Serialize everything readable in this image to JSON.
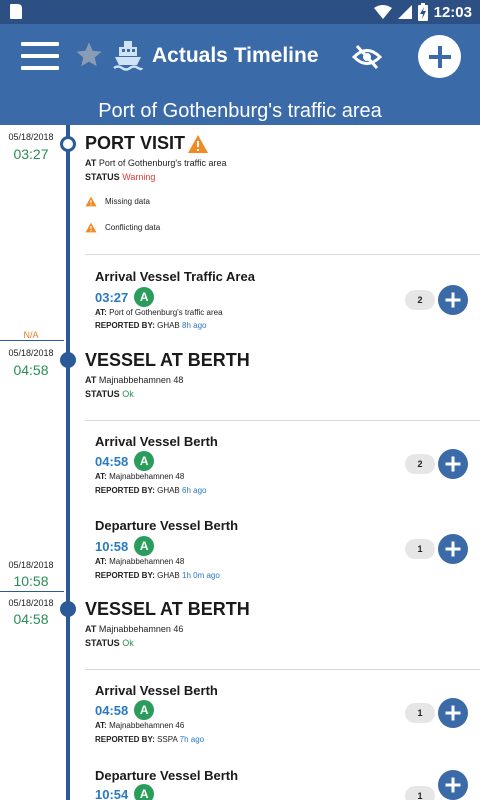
{
  "status_bar": {
    "time": "12:03"
  },
  "app_bar": {
    "title": "Actuals Timeline"
  },
  "subheader": {
    "area": "Port of Gothenburg's traffic area"
  },
  "left_column": {
    "port_visit": {
      "date": "05/18/2018",
      "time": "03:27"
    },
    "na_label": "N/A",
    "berth1": {
      "date": "05/18/2018",
      "time": "04:58"
    },
    "berth1_end": {
      "date": "05/18/2018",
      "time": "10:58"
    },
    "berth2": {
      "date": "05/18/2018",
      "time": "04:58"
    }
  },
  "port_visit": {
    "title": "PORT VISIT",
    "at_label": "AT",
    "at_value": "Port of Gothenburg's traffic area",
    "status_label": "STATUS",
    "status_value": "Warning",
    "issues": [
      "Missing data",
      "Conflicting data"
    ]
  },
  "berth_visits": [
    {
      "title": "VESSEL AT BERTH",
      "at_label": "AT",
      "at_value": "Majnabbehamnen 48",
      "status_label": "STATUS",
      "status_value": "Ok"
    },
    {
      "title": "VESSEL AT BERTH",
      "at_label": "AT",
      "at_value": "Majnabbehamnen 46",
      "status_label": "STATUS",
      "status_value": "Ok"
    }
  ],
  "events": [
    {
      "title": "Arrival Vessel Traffic Area",
      "time": "03:27",
      "badge": "A",
      "at_label": "AT:",
      "at_value": "Port of Gothenburg's traffic area",
      "reported_label": "REPORTED BY:",
      "reporter": "GHAB",
      "ago": "8h ago",
      "count": "2"
    },
    {
      "title": "Arrival Vessel Berth",
      "time": "04:58",
      "badge": "A",
      "at_label": "AT:",
      "at_value": "Majnabbehamnen 48",
      "reported_label": "REPORTED BY:",
      "reporter": "GHAB",
      "ago": "6h ago",
      "count": "2"
    },
    {
      "title": "Departure Vessel Berth",
      "time": "10:58",
      "badge": "A",
      "at_label": "AT:",
      "at_value": "Majnabbehamnen 48",
      "reported_label": "REPORTED BY:",
      "reporter": "GHAB",
      "ago": "1h 0m ago",
      "count": "1"
    },
    {
      "title": "Arrival Vessel Berth",
      "time": "04:58",
      "badge": "A",
      "at_label": "AT:",
      "at_value": "Majnabbehamnen 46",
      "reported_label": "REPORTED BY:",
      "reporter": "SSPA",
      "ago": "7h ago",
      "count": "1"
    },
    {
      "title": "Departure Vessel Berth",
      "time": "10:54",
      "badge": "A",
      "count": "1"
    }
  ],
  "colors": {
    "primary": "#3a6aa8",
    "status_bar": "#2c4f84",
    "warning": "#e53935",
    "ok": "#2a8c55",
    "time_blue": "#2a7abf",
    "badge_green": "#2a9d5c",
    "na_orange": "#e67e22"
  }
}
